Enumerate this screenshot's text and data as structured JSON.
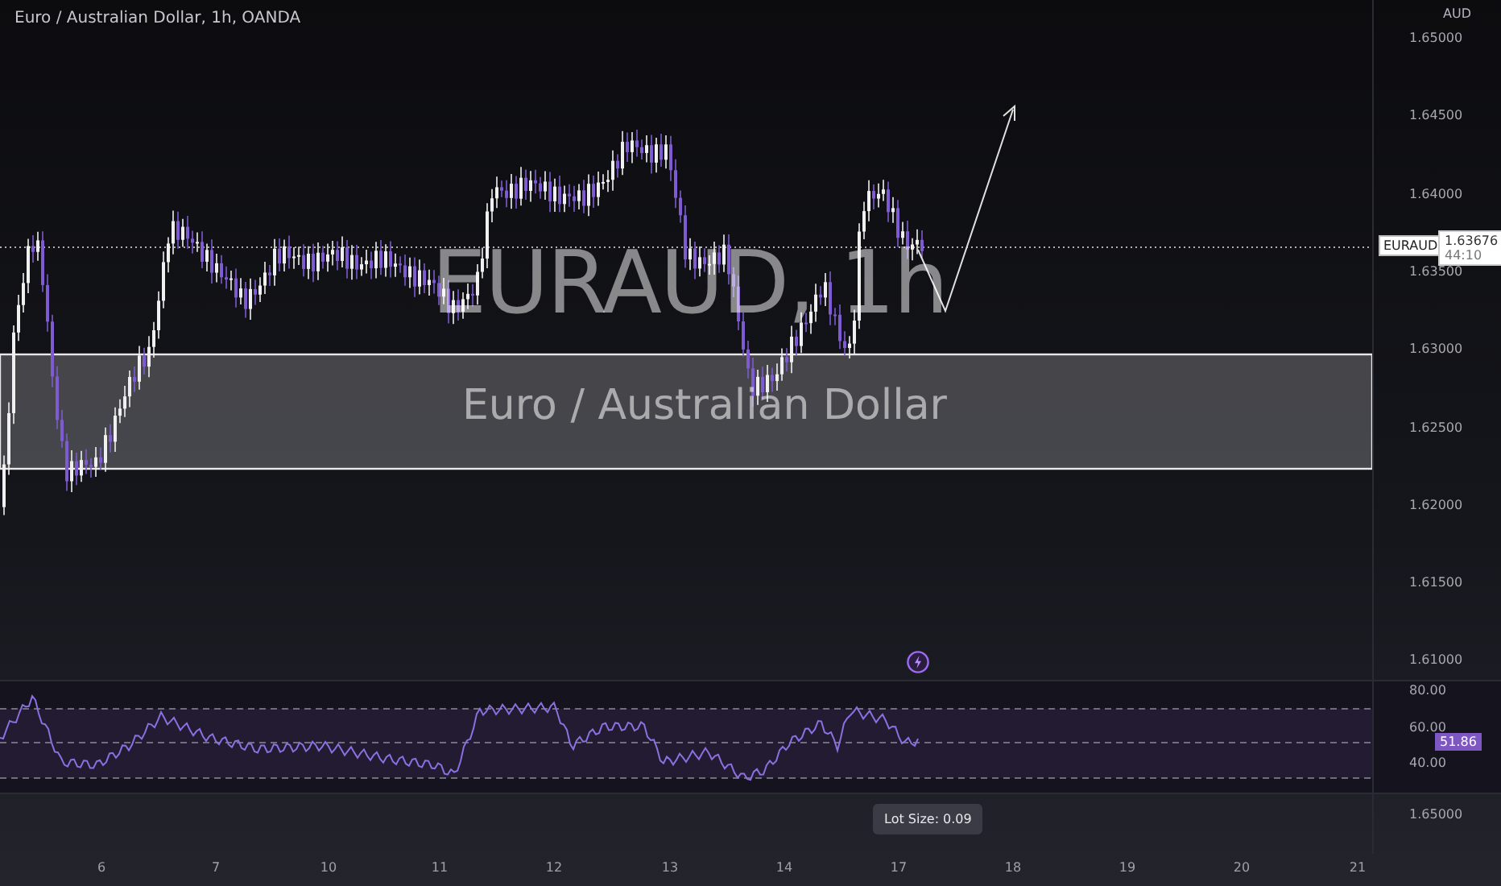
{
  "header": {
    "title": "Euro / Australian Dollar, 1h, OANDA"
  },
  "chart_watermark": {
    "symbol": "EURAUD, 1h",
    "name": "Euro / Australian Dollar"
  },
  "price_axis": {
    "currency": "AUD",
    "ticks": [
      "1.65000",
      "1.64500",
      "1.64000",
      "1.63500",
      "1.63000",
      "1.62500",
      "1.62000",
      "1.61500",
      "1.61000"
    ]
  },
  "price_tag": {
    "symbol": "EURAUD",
    "price": "1.63676",
    "countdown": "44:10"
  },
  "rsi": {
    "ticks": [
      "80.00",
      "60.00",
      "40.00"
    ],
    "value": "51.86"
  },
  "lower_pane": {
    "tick": "1.65000"
  },
  "lot_size_tooltip": "Lot Size: 0.09",
  "time_axis": [
    "6",
    "7",
    "10",
    "11",
    "12",
    "13",
    "14",
    "17",
    "18",
    "19",
    "20",
    "21"
  ]
}
